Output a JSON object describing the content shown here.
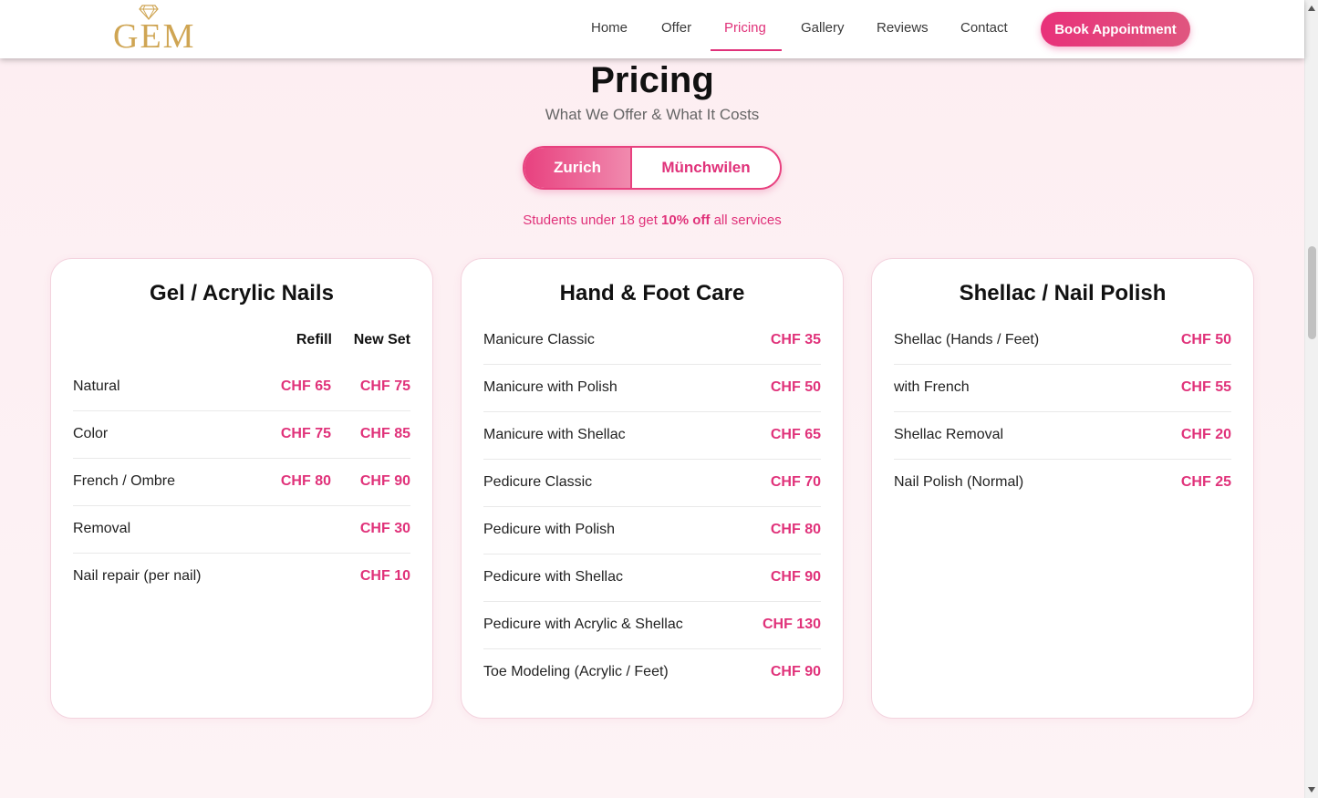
{
  "brand": {
    "logo_text": "GEM",
    "logo_color": "#cfa553"
  },
  "nav": {
    "items": [
      {
        "label": "Home"
      },
      {
        "label": "Offer"
      },
      {
        "label": "Pricing"
      },
      {
        "label": "Gallery"
      },
      {
        "label": "Reviews"
      },
      {
        "label": "Contact"
      }
    ],
    "active": "Pricing",
    "cta": "Book Appointment"
  },
  "colors": {
    "accent": "#e0327a",
    "background": "#fdeef2",
    "gold": "#cfa553"
  },
  "pricing": {
    "title": "Pricing",
    "subtitle": "What We Offer & What It Costs",
    "locations": [
      "Zurich",
      "Münchwilen"
    ],
    "active_location": "Zurich",
    "promo": {
      "prefix": "Students under 18 get",
      "highlight": "10% off",
      "suffix": "all services"
    }
  },
  "cards": [
    {
      "title": "Gel / Acrylic Nails",
      "columns": [
        "Refill",
        "New Set"
      ],
      "rows": [
        {
          "name": "Natural",
          "refill": "CHF 65",
          "new_set": "CHF 75"
        },
        {
          "name": "Color",
          "refill": "CHF 75",
          "new_set": "CHF 85"
        },
        {
          "name": "French / Ombre",
          "refill": "CHF 80",
          "new_set": "CHF 90"
        },
        {
          "name": "Removal",
          "refill": "",
          "new_set": "CHF 30"
        },
        {
          "name": "Nail repair (per nail)",
          "refill": "",
          "new_set": "CHF 10"
        }
      ]
    },
    {
      "title": "Hand & Foot Care",
      "rows": [
        {
          "name": "Manicure Classic",
          "price": "CHF 35"
        },
        {
          "name": "Manicure with Polish",
          "price": "CHF 50"
        },
        {
          "name": "Manicure with Shellac",
          "price": "CHF 65"
        },
        {
          "name": "Pedicure Classic",
          "price": "CHF 70"
        },
        {
          "name": "Pedicure with Polish",
          "price": "CHF 80"
        },
        {
          "name": "Pedicure with Shellac",
          "price": "CHF 90"
        },
        {
          "name": "Pedicure with Acrylic & Shellac",
          "price": "CHF 130"
        },
        {
          "name": "Toe Modeling (Acrylic / Feet)",
          "price": "CHF 90"
        }
      ]
    },
    {
      "title": "Shellac / Nail Polish",
      "rows": [
        {
          "name": "Shellac (Hands / Feet)",
          "price": "CHF 50"
        },
        {
          "name": "with French",
          "price": "CHF 55"
        },
        {
          "name": "Shellac Removal",
          "price": "CHF 20"
        },
        {
          "name": "Nail Polish (Normal)",
          "price": "CHF 25"
        }
      ]
    }
  ]
}
